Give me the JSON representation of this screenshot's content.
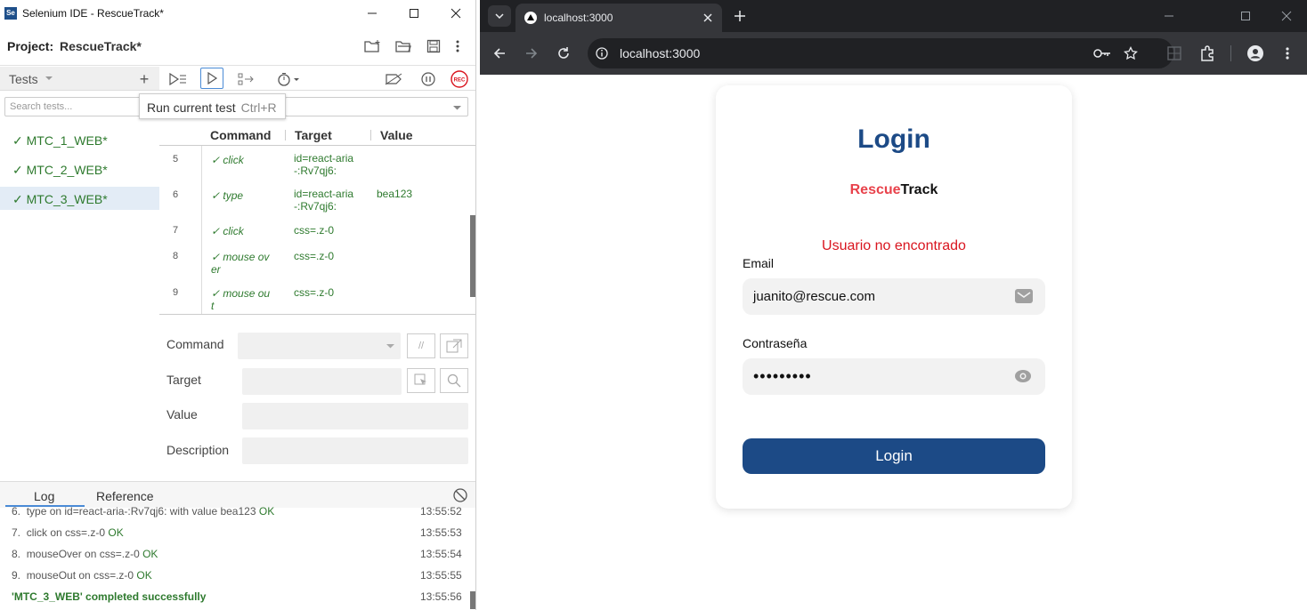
{
  "ide": {
    "window_title": "Selenium IDE - RescueTrack*",
    "logo": "Se",
    "project_label": "Project:",
    "project_name": "RescueTrack*",
    "tests_label": "Tests",
    "search_placeholder": "Search tests...",
    "tooltip": {
      "text": "Run current test",
      "shortcut": "Ctrl+R"
    },
    "tests": [
      {
        "name": "MTC_1_WEB*",
        "status": "passed"
      },
      {
        "name": "MTC_2_WEB*",
        "status": "passed"
      },
      {
        "name": "MTC_3_WEB*",
        "status": "passed",
        "selected": true
      }
    ],
    "columns": {
      "command": "Command",
      "target": "Target",
      "value": "Value"
    },
    "rows": [
      {
        "num": "5",
        "command": "✓ click",
        "target": "id=react-aria\n-:Rv7qj6:",
        "value": ""
      },
      {
        "num": "6",
        "command": "✓ type",
        "target": "id=react-aria\n-:Rv7qj6:",
        "value": "bea123"
      },
      {
        "num": "7",
        "command": "✓ click",
        "target": "css=.z-0",
        "value": ""
      },
      {
        "num": "8",
        "command": "✓ mouse ov\ner",
        "target": "css=.z-0",
        "value": ""
      },
      {
        "num": "9",
        "command": "✓ mouse ou\nt",
        "target": "css=.z-0",
        "value": ""
      }
    ],
    "form": {
      "command": "Command",
      "target": "Target",
      "value": "Value",
      "description": "Description"
    },
    "log_tabs": {
      "log": "Log",
      "reference": "Reference"
    },
    "log": [
      {
        "num": "6.",
        "text": "type on id=react-aria-:Rv7qj6: with value bea123",
        "status": "OK",
        "time": "13:55:52"
      },
      {
        "num": "7.",
        "text": "click on css=.z-0",
        "status": "OK",
        "time": "13:55:53"
      },
      {
        "num": "8.",
        "text": "mouseOver on css=.z-0",
        "status": "OK",
        "time": "13:55:54"
      },
      {
        "num": "9.",
        "text": "mouseOut on css=.z-0",
        "status": "OK",
        "time": "13:55:55"
      }
    ],
    "log_done": {
      "text": "'MTC_3_WEB' completed successfully",
      "time": "13:55:56"
    },
    "colors": {
      "pass": "#2e7a2e",
      "selected_bg": "#e3ecf6",
      "rec": "#d9151f"
    }
  },
  "chrome": {
    "tab_title": "localhost:3000",
    "url": "localhost:3000"
  },
  "page": {
    "title": "Login",
    "brand_a": "Rescue",
    "brand_b": "Track",
    "error": "Usuario no encontrado",
    "email_label": "Email",
    "email_value": "juanito@rescue.com",
    "password_label": "Contraseña",
    "password_value": "•••••••••",
    "login_button": "Login",
    "colors": {
      "primary": "#1c4a86",
      "brand_red": "#e8424b",
      "error": "#d9151f"
    }
  }
}
